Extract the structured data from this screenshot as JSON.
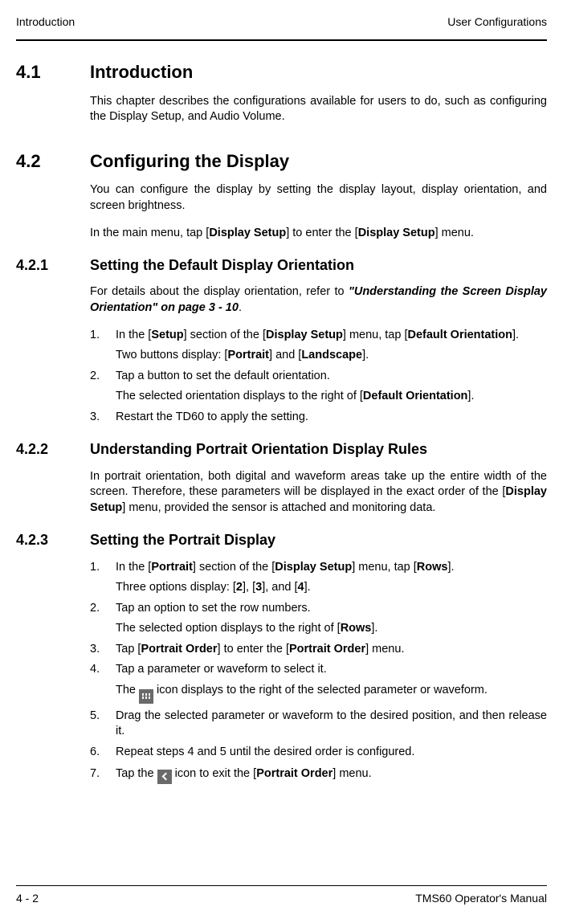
{
  "header": {
    "left": "Introduction",
    "right": "User Configurations"
  },
  "s41": {
    "num": "4.1",
    "title": "Introduction",
    "p1": "This chapter describes the configurations available for users to do, such as configuring the Display Setup, and Audio Volume."
  },
  "s42": {
    "num": "4.2",
    "title": "Configuring the Display",
    "p1": "You can configure the display by setting the display layout, display orientation, and screen brightness.",
    "p2a": "In the main menu, tap [",
    "p2b": "Display Setup",
    "p2c": "] to enter the [",
    "p2d": "Display Setup",
    "p2e": "] menu."
  },
  "s421": {
    "num": "4.2.1",
    "title": "Setting the Default Display Orientation",
    "p1a": "For details about the display orientation, refer to ",
    "p1b": "\"Understanding the Screen Display Orientation\" on page 3 - 10",
    "p1c": ".",
    "step1n": "1.",
    "step1a": "In the [",
    "step1b": "Setup",
    "step1c": "] section of the [",
    "step1d": "Display Setup",
    "step1e": "] menu, tap [",
    "step1f": "Default Orientation",
    "step1g": "].",
    "sub1a": "Two buttons display: [",
    "sub1b": "Portrait",
    "sub1c": "] and [",
    "sub1d": "Landscape",
    "sub1e": "].",
    "step2n": "2.",
    "step2": "Tap a button to set the default orientation.",
    "sub2a": "The selected orientation displays to the right of [",
    "sub2b": "Default Orientation",
    "sub2c": "].",
    "step3n": "3.",
    "step3": "Restart the TD60 to apply the setting."
  },
  "s422": {
    "num": "4.2.2",
    "title": "Understanding Portrait Orientation Display Rules",
    "p1a": "In portrait orientation, both digital and waveform areas take up the entire width of the screen. Therefore, these parameters will be displayed in the exact order of the [",
    "p1b": "Display Setup",
    "p1c": "] menu, provided the sensor is attached and monitoring data."
  },
  "s423": {
    "num": "4.2.3",
    "title": "Setting the Portrait Display",
    "step1n": "1.",
    "step1a": "In the [",
    "step1b": "Portrait",
    "step1c": "] section of the [",
    "step1d": "Display Setup",
    "step1e": "] menu, tap [",
    "step1f": "Rows",
    "step1g": "].",
    "sub1a": "Three options display: [",
    "sub1b": "2",
    "sub1c": "], [",
    "sub1d": "3",
    "sub1e": "], and [",
    "sub1f": "4",
    "sub1g": "].",
    "step2n": "2.",
    "step2": "Tap an option to set the row numbers.",
    "sub2a": "The selected option displays to the right of [",
    "sub2b": "Rows",
    "sub2c": "].",
    "step3n": "3.",
    "step3a": "Tap [",
    "step3b": "Portrait Order",
    "step3c": "] to enter the [",
    "step3d": "Portrait Order",
    "step3e": "] menu.",
    "step4n": "4.",
    "step4": "Tap a parameter or waveform to select it.",
    "sub4a": "The ",
    "sub4b": " icon displays to the right of the selected parameter or waveform.",
    "step5n": "5.",
    "step5": "Drag the selected parameter or waveform to the desired position, and then release it.",
    "step6n": "6.",
    "step6": "Repeat steps 4 and 5 until the desired order is configured.",
    "step7n": "7.",
    "step7a": "Tap the ",
    "step7b": " icon to exit the [",
    "step7c": "Portrait Order",
    "step7d": "] menu."
  },
  "footer": {
    "left": "4 - 2",
    "right": "TMS60 Operator's Manual"
  }
}
